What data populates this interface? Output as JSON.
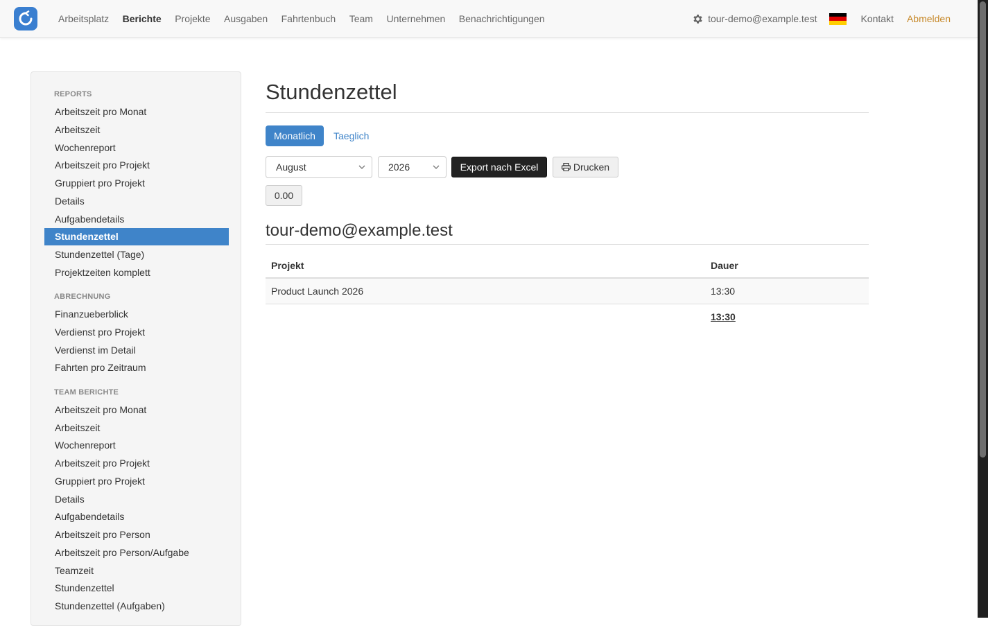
{
  "nav": {
    "items": [
      {
        "label": "Arbeitsplatz"
      },
      {
        "label": "Berichte"
      },
      {
        "label": "Projekte"
      },
      {
        "label": "Ausgaben"
      },
      {
        "label": "Fahrtenbuch"
      },
      {
        "label": "Team"
      },
      {
        "label": "Unternehmen"
      },
      {
        "label": "Benachrichtigungen"
      }
    ],
    "active_index": 1,
    "user_email": "tour-demo@example.test",
    "contact_label": "Kontakt",
    "logout_label": "Abmelden",
    "accent_color": "#3f84c9",
    "logout_color": "#c7892a"
  },
  "sidebar": {
    "sections": [
      {
        "heading": "REPORTS",
        "items": [
          {
            "label": "Arbeitszeit pro Monat"
          },
          {
            "label": "Arbeitszeit"
          },
          {
            "label": "Wochenreport"
          },
          {
            "label": "Arbeitszeit pro Projekt"
          },
          {
            "label": "Gruppiert pro Projekt"
          },
          {
            "label": "Details"
          },
          {
            "label": "Aufgabendetails"
          },
          {
            "label": "Stundenzettel"
          },
          {
            "label": "Stundenzettel (Tage)"
          },
          {
            "label": "Projektzeiten komplett"
          }
        ]
      },
      {
        "heading": "ABRECHNUNG",
        "items": [
          {
            "label": "Finanzueberblick"
          },
          {
            "label": "Verdienst pro Projekt"
          },
          {
            "label": "Verdienst im Detail"
          },
          {
            "label": "Fahrten pro Zeitraum"
          }
        ]
      },
      {
        "heading": "TEAM BERICHTE",
        "items": [
          {
            "label": "Arbeitszeit pro Monat"
          },
          {
            "label": "Arbeitszeit"
          },
          {
            "label": "Wochenreport"
          },
          {
            "label": "Arbeitszeit pro Projekt"
          },
          {
            "label": "Gruppiert pro Projekt"
          },
          {
            "label": "Details"
          },
          {
            "label": "Aufgabendetails"
          },
          {
            "label": "Arbeitszeit pro Person"
          },
          {
            "label": "Arbeitszeit pro Person/Aufgabe"
          },
          {
            "label": "Teamzeit"
          },
          {
            "label": "Stundenzettel"
          },
          {
            "label": "Stundenzettel (Aufgaben)"
          }
        ]
      }
    ],
    "active": "Stundenzettel"
  },
  "main": {
    "title": "Stundenzettel",
    "tabs": [
      {
        "label": "Monatlich",
        "active": true
      },
      {
        "label": "Taeglich",
        "active": false
      }
    ],
    "month_select": {
      "value": "August"
    },
    "year_select": {
      "value": "2026"
    },
    "export_label": "Export nach Excel",
    "print_label": "Drucken",
    "value_button": "0.00",
    "user_heading": "tour-demo@example.test",
    "table": {
      "columns": [
        "Projekt",
        "Dauer"
      ],
      "rows": [
        {
          "project": "Product Launch 2026",
          "duration": "13:30"
        }
      ],
      "total": "13:30"
    }
  }
}
